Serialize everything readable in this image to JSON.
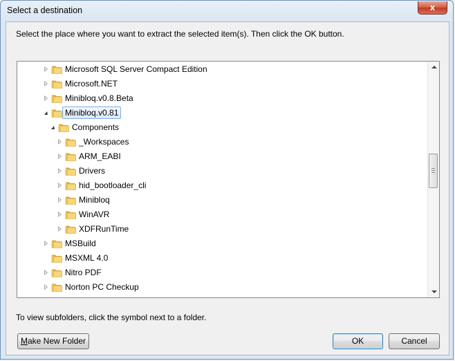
{
  "window": {
    "title": "Select a destination",
    "close_label": "x"
  },
  "instruction": "Select the place where you want to extract the selected item(s).  Then click the OK button.",
  "tree": {
    "items": [
      {
        "label": "Microsoft SQL Server Compact Edition",
        "level": 0,
        "expander": "closed",
        "selected": false
      },
      {
        "label": "Microsoft.NET",
        "level": 0,
        "expander": "closed",
        "selected": false
      },
      {
        "label": "Minibloq.v0.8.Beta",
        "level": 0,
        "expander": "closed",
        "selected": false
      },
      {
        "label": "Minibloq.v0.81",
        "level": 0,
        "expander": "open",
        "selected": true
      },
      {
        "label": "Components",
        "level": 1,
        "expander": "open",
        "selected": false
      },
      {
        "label": "_Workspaces",
        "level": 2,
        "expander": "closed",
        "selected": false
      },
      {
        "label": "ARM_EABI",
        "level": 2,
        "expander": "closed",
        "selected": false
      },
      {
        "label": "Drivers",
        "level": 2,
        "expander": "closed",
        "selected": false
      },
      {
        "label": "hid_bootloader_cli",
        "level": 2,
        "expander": "closed",
        "selected": false
      },
      {
        "label": "Minibloq",
        "level": 2,
        "expander": "closed",
        "selected": false
      },
      {
        "label": "WinAVR",
        "level": 2,
        "expander": "closed",
        "selected": false
      },
      {
        "label": "XDFRunTime",
        "level": 2,
        "expander": "closed",
        "selected": false
      },
      {
        "label": "MSBuild",
        "level": 0,
        "expander": "closed",
        "selected": false
      },
      {
        "label": "MSXML 4.0",
        "level": 0,
        "expander": "none",
        "selected": false
      },
      {
        "label": "Nitro PDF",
        "level": 0,
        "expander": "closed",
        "selected": false
      },
      {
        "label": "Norton PC Checkup",
        "level": 0,
        "expander": "closed",
        "selected": false
      }
    ]
  },
  "hint": "To view subfolders, click the symbol next to a folder.",
  "buttons": {
    "make_new_folder_first": "M",
    "make_new_folder_rest": "ake New Folder",
    "ok": "OK",
    "cancel": "Cancel"
  },
  "colors": {
    "folder_light": "#f7d77a",
    "folder_dark": "#d9a93e",
    "selection_border": "#84acdd"
  },
  "icons": {
    "folder": "folder-icon",
    "expand": "triangle-right-icon",
    "collapse": "triangle-down-icon"
  }
}
